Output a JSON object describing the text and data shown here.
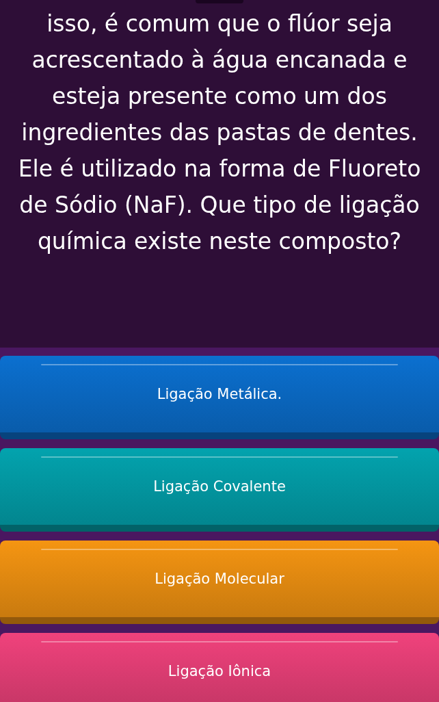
{
  "question": "isso, é comum que o flúor seja acrescentado à água encanada e esteja presente como um dos ingredientes das pastas de dentes. Ele é utilizado na forma de Fluoreto de Sódio (NaF). Que tipo de ligação química existe neste composto?",
  "answers": [
    {
      "label": "Ligação Metálica.",
      "color": "#0b70d0"
    },
    {
      "label": "Ligação Covalente",
      "color": "#03a3ae"
    },
    {
      "label": "Ligação Molecular",
      "color": "#f59512"
    },
    {
      "label": "Ligação Iônica",
      "color": "#f0427c"
    }
  ]
}
